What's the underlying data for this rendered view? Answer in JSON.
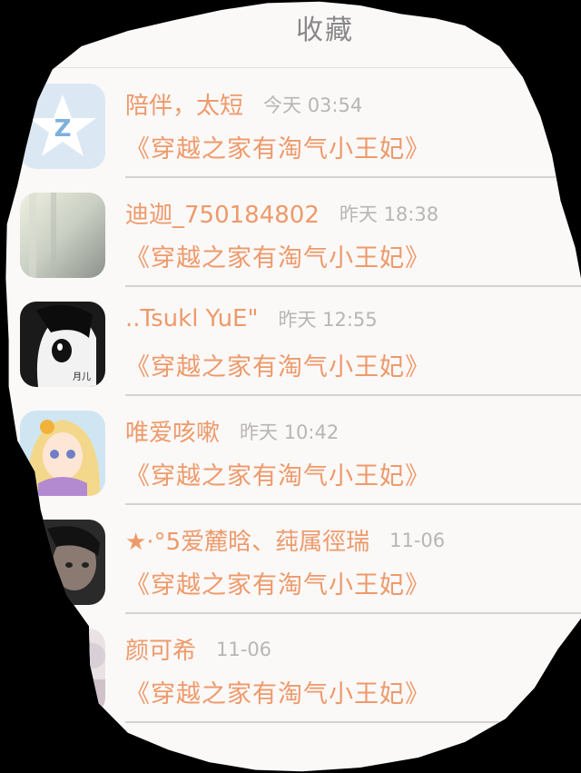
{
  "header": {
    "title": "收藏"
  },
  "favorites": [
    {
      "name": "陪伴，太短",
      "time": "今天 03:54",
      "book": "《穿越之家有淘气小王妃》",
      "avatar": "qzone-star-avatar"
    },
    {
      "name": "迪迦_750184802",
      "time": "昨天 18:38",
      "book": "《穿越之家有淘气小王妃》",
      "avatar": "blurred-photo-avatar"
    },
    {
      "name": "..Tsukl YuE\"",
      "time": "昨天 12:55",
      "book": "《穿越之家有淘气小王妃》",
      "avatar": "anime-girl-bw-avatar"
    },
    {
      "name": "唯爱咳嗽",
      "time": "昨天 10:42",
      "book": "《穿越之家有淘气小王妃》",
      "avatar": "anime-girl-blonde-avatar"
    },
    {
      "name": "★·°5爱麓晗、莼属徑瑞",
      "time": "11-06",
      "book": "《穿越之家有淘气小王妃》",
      "avatar": "boy-photo-avatar"
    },
    {
      "name": "颜可希",
      "time": "11-06",
      "book": "《穿越之家有淘气小王妃》",
      "avatar": "partial-avatar"
    }
  ],
  "colors": {
    "accent": "#ed9a6a",
    "muted": "#b9b5b5",
    "background": "#fbf8f8"
  }
}
